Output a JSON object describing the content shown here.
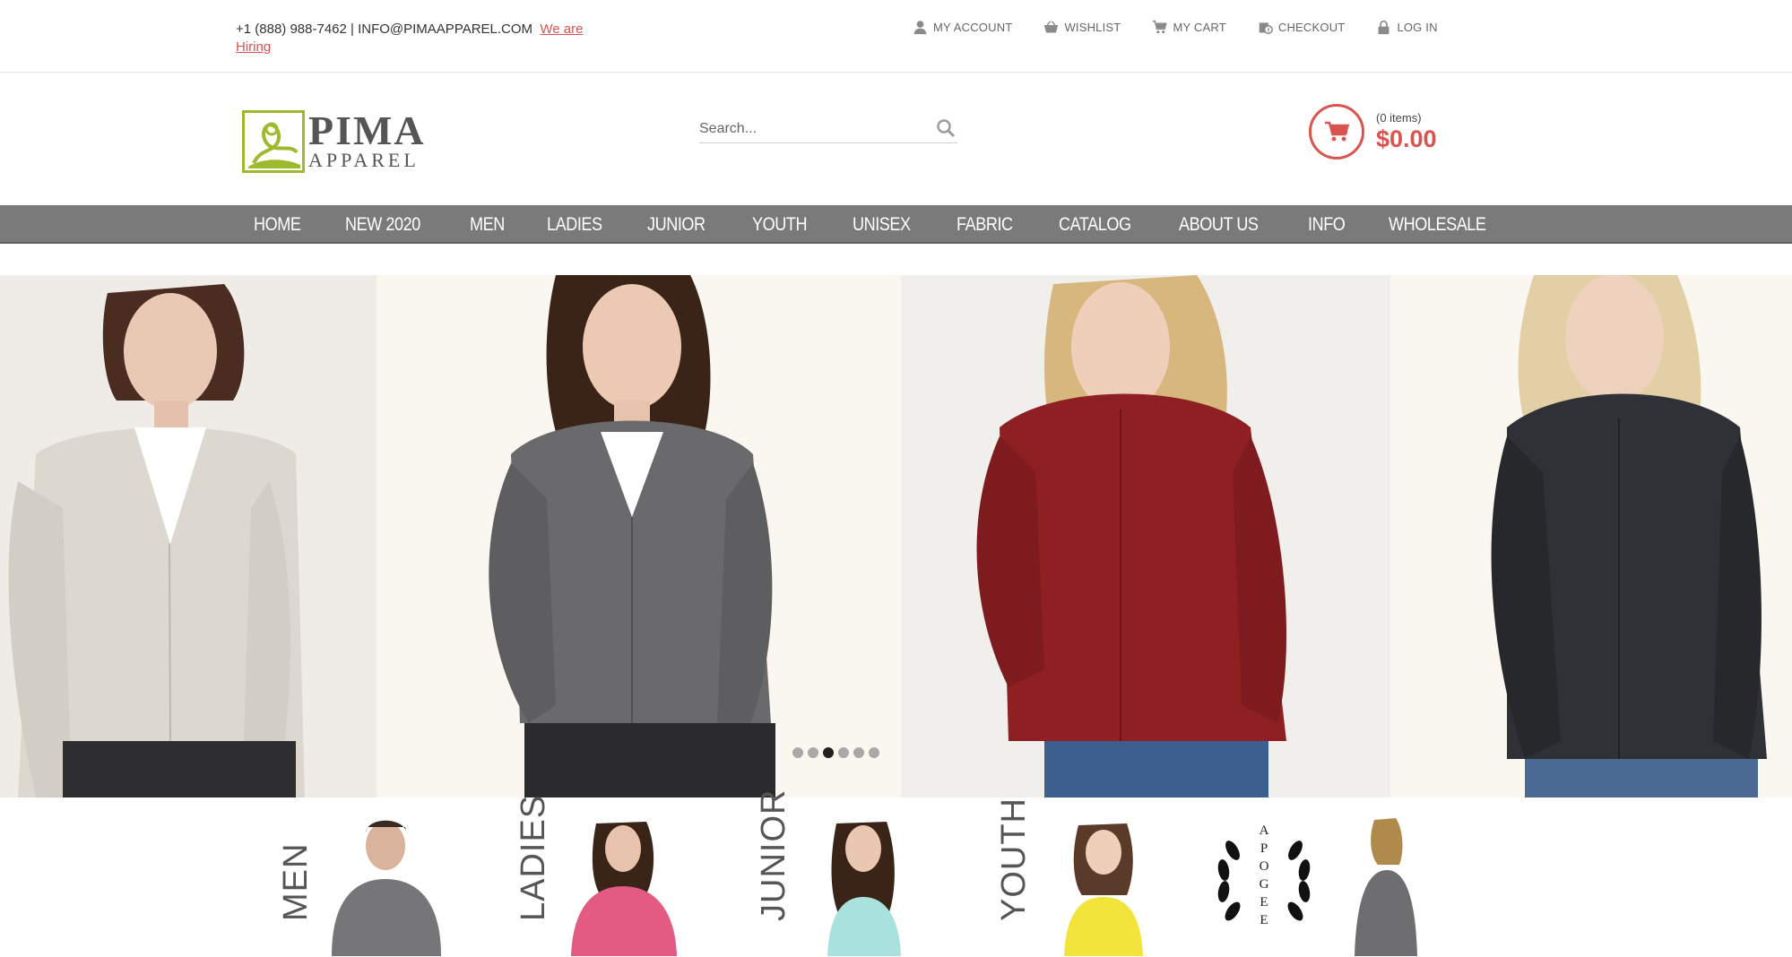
{
  "topbar": {
    "contact": "+1 (888) 988-7462 | INFO@PIMAAPPAREL.COM",
    "hiring_link": "We are Hiring",
    "links": [
      {
        "label": "MY ACCOUNT",
        "icon": "user-icon"
      },
      {
        "label": "WISHLIST",
        "icon": "basket-icon"
      },
      {
        "label": "MY CART",
        "icon": "cart-icon"
      },
      {
        "label": "CHECKOUT",
        "icon": "checkout-icon"
      },
      {
        "label": "LOG IN",
        "icon": "lock-icon"
      }
    ]
  },
  "logo": {
    "line1": "PIMA",
    "line2": "APPAREL"
  },
  "search": {
    "placeholder": "Search..."
  },
  "cart": {
    "items": "(0 items)",
    "total": "$0.00"
  },
  "nav": [
    "HOME",
    "NEW 2020",
    "MEN",
    "LADIES",
    "JUNIOR",
    "YOUTH",
    "UNISEX",
    "FABRIC",
    "CATALOG",
    "ABOUT US",
    "INFO",
    "WHOLESALE"
  ],
  "slider": {
    "dot_count": 6,
    "active_index": 2
  },
  "categories": [
    {
      "label": "MEN"
    },
    {
      "label": "LADIES"
    },
    {
      "label": "JUNIOR"
    },
    {
      "label": "YOUTH"
    },
    {
      "label": "APOGEE"
    }
  ],
  "colors": {
    "accent": "#d9534f",
    "nav": "#7a7a7a",
    "logo_green": "#9cba2b"
  }
}
